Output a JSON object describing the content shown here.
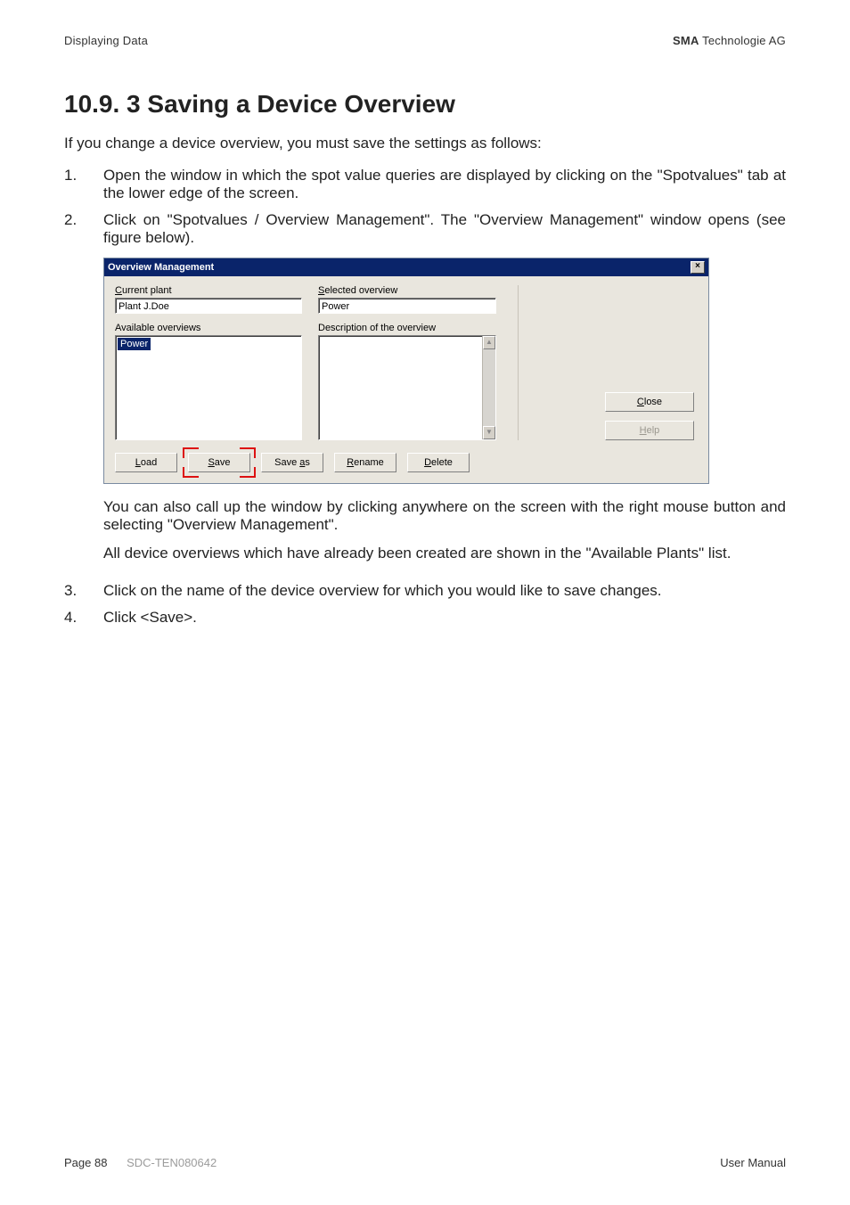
{
  "header": {
    "left": "Displaying Data",
    "right_bold": "SMA",
    "right_rest": " Technologie AG"
  },
  "title": "10.9. 3 Saving a Device Overview",
  "lead": "If you change a device overview, you must save the settings as follows:",
  "steps": {
    "s1_num": "1.",
    "s1_text": "Open the window in which the spot value queries are displayed by clicking on the \"Spotvalues\" tab at the lower edge of the screen.",
    "s2_num": "2.",
    "s2_text": "Click on \"Spotvalues / Overview Management\". The \"Overview Management\" window opens (see figure below).",
    "s2_p1": "You can also call up the window by clicking anywhere on the screen with the right mouse button and selecting \"Overview Management\".",
    "s2_p2": "All device overviews which have already been created are shown in the \"Available Plants\" list.",
    "s3_num": "3.",
    "s3_text": "Click on the name of the device overview for which you would like to save changes.",
    "s4_num": "4.",
    "s4_text": "Click <Save>."
  },
  "dialog": {
    "title": "Overview Management",
    "close_glyph": "×",
    "current_plant_label_pre": "",
    "current_plant_label_u": "C",
    "current_plant_label_post": "urrent plant",
    "current_plant_value": "Plant J.Doe",
    "available_label": "Available overviews",
    "available_item": "Power",
    "selected_label_u": "S",
    "selected_label_post": "elected overview",
    "selected_value": "Power",
    "description_label": "Description of the overview",
    "scroll_up": "▲",
    "scroll_down": "▼",
    "btn_load_u": "L",
    "btn_load_post": "oad",
    "btn_save_u": "S",
    "btn_save_post": "ave",
    "btn_saveas_pre": "Save ",
    "btn_saveas_u": "a",
    "btn_saveas_post": "s",
    "btn_rename_u": "R",
    "btn_rename_post": "ename",
    "btn_delete_u": "D",
    "btn_delete_post": "elete",
    "btn_close_u": "C",
    "btn_close_post": "lose",
    "btn_help_u": "H",
    "btn_help_post": "elp"
  },
  "footer": {
    "page": "Page 88",
    "docid": "SDC-TEN080642",
    "right": "User Manual"
  }
}
